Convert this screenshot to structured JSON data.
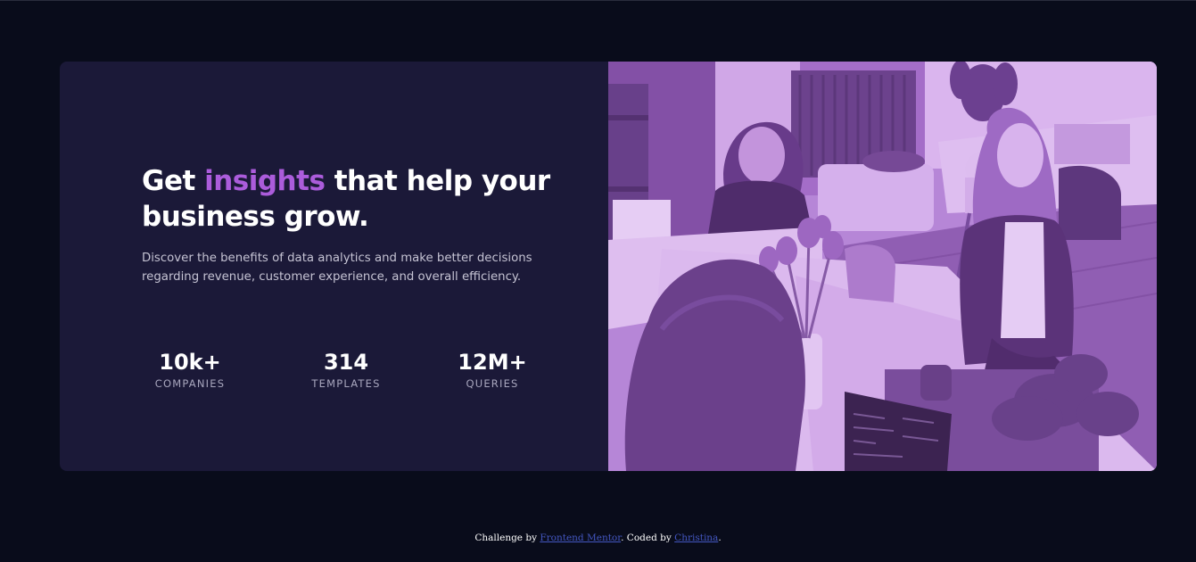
{
  "hero": {
    "headline": {
      "before": "Get ",
      "accent": "insights",
      "after": " that help your business grow."
    },
    "description": "Discover the benefits of data analytics and make better decisions regarding revenue, customer experience, and overall efficiency.",
    "stats": [
      {
        "value": "10k+",
        "label": "COMPANIES"
      },
      {
        "value": "314",
        "label": "TEMPLATES"
      },
      {
        "value": "12M+",
        "label": "QUERIES"
      }
    ],
    "image": {
      "subject": "people-working-in-office",
      "overlay_color": "#aa5cdb"
    }
  },
  "footer": {
    "prefix": "Challenge by ",
    "challenge_link": "Frontend Mentor",
    "middle": ". Coded by ",
    "author_link": "Christina",
    "suffix": "."
  },
  "colors": {
    "page_background": "#090c1b",
    "card_background": "#1b1938",
    "accent": "#ab5cdb",
    "heading": "#ffffff",
    "body_text": "#c5c3d3",
    "stat_label": "#a8a6bd",
    "link": "#4457c2"
  }
}
